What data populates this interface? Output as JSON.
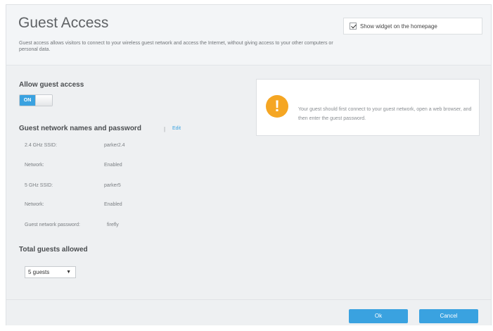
{
  "header": {
    "title": "Guest Access",
    "description": "Guest access allows visitors to connect to your wireless guest network and access the Internet, without giving access to your other computers or personal data.",
    "widget_toggle_label": "Show widget on the homepage",
    "widget_toggle_checked": true
  },
  "allow_guest": {
    "title": "Allow guest access",
    "toggle_label": "ON",
    "enabled": true
  },
  "networks": {
    "title": "Guest network names and password",
    "separator": "|",
    "edit_label": "Edit",
    "rows": [
      {
        "label": "2.4 GHz SSID:",
        "value": "parker2.4"
      },
      {
        "label": "Network:",
        "value": "Enabled"
      },
      {
        "label": "5 GHz SSID:",
        "value": "parker5"
      },
      {
        "label": "Network:",
        "value": "Enabled"
      },
      {
        "label": "Guest network password:",
        "value": "firefly"
      }
    ]
  },
  "total_guests": {
    "title": "Total guests allowed",
    "selected": "5 guests"
  },
  "notice": {
    "text": "Your guest should first connect to your guest network, open a web browser, and then enter the guest password."
  },
  "footer": {
    "ok_label": "Ok",
    "cancel_label": "Cancel"
  },
  "colors": {
    "accent": "#3aa2e0",
    "warning": "#f5a623"
  },
  "icons": {
    "close": "close-icon",
    "warning": "warning-icon",
    "dropdown": "chevron-down-icon"
  }
}
